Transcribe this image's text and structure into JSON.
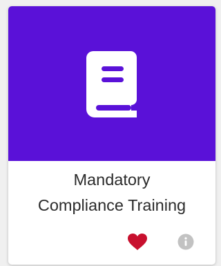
{
  "card": {
    "title_line1": "Mandatory",
    "title_line2": "Compliance Training",
    "banner_color": "#5a11d8",
    "image_icon": "book-icon",
    "favorite_icon": "heart-icon",
    "favorite_color": "#c8102e",
    "info_icon": "info-icon",
    "info_color": "#c2c2c2"
  }
}
